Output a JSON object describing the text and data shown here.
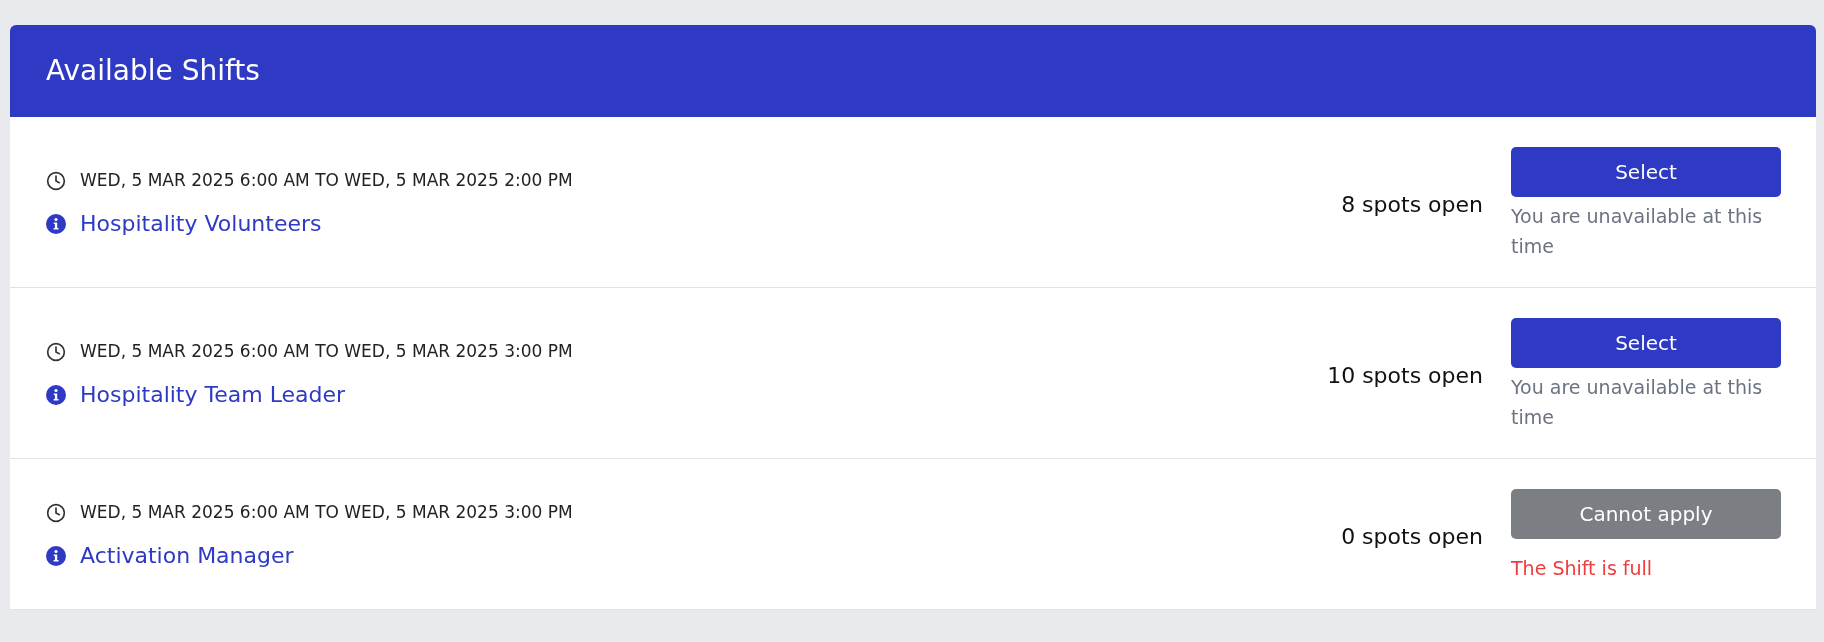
{
  "header": {
    "title": "Available Shifts"
  },
  "shifts": [
    {
      "time": "WED, 5 MAR 2025 6:00 AM TO WED, 5 MAR 2025 2:00 PM",
      "name": "Hospitality Volunteers",
      "spots": "8 spots open",
      "button": {
        "label": "Select",
        "disabled": false
      },
      "note": {
        "text": "You are unavailable at this time",
        "kind": "info"
      }
    },
    {
      "time": "WED, 5 MAR 2025 6:00 AM TO WED, 5 MAR 2025 3:00 PM",
      "name": "Hospitality Team Leader",
      "spots": "10 spots open",
      "button": {
        "label": "Select",
        "disabled": false
      },
      "note": {
        "text": "You are unavailable at this time",
        "kind": "info"
      }
    },
    {
      "time": "WED, 5 MAR 2025 6:00 AM TO WED, 5 MAR 2025 3:00 PM",
      "name": "Activation Manager",
      "spots": "0 spots open",
      "button": {
        "label": "Cannot apply",
        "disabled": true
      },
      "note": {
        "text": "The Shift is full",
        "kind": "error"
      }
    }
  ]
}
